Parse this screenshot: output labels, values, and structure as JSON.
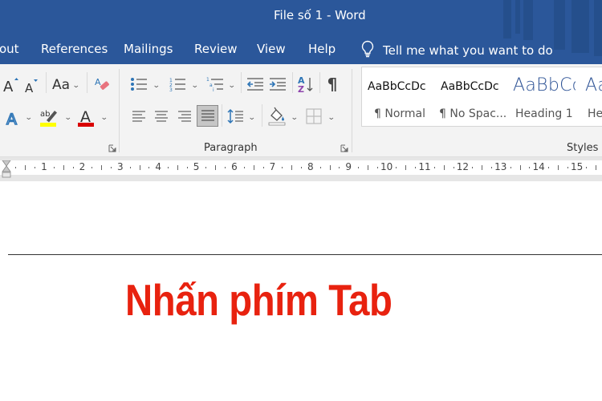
{
  "window": {
    "title": "File số 1  -  Word"
  },
  "tabs": [
    {
      "label": "out",
      "partial": true
    },
    {
      "label": "References"
    },
    {
      "label": "Mailings"
    },
    {
      "label": "Review"
    },
    {
      "label": "View"
    },
    {
      "label": "Help"
    }
  ],
  "tell_me": {
    "icon": "lightbulb-icon",
    "placeholder": "Tell me what you want to do"
  },
  "ribbon": {
    "font_group": {
      "buttons": [
        {
          "name": "grow-font",
          "icon": "grow-font-icon"
        },
        {
          "name": "shrink-font",
          "icon": "shrink-font-icon"
        },
        {
          "name": "change-case",
          "icon": "change-case-icon",
          "label": "Aa"
        },
        {
          "name": "clear-formatting",
          "icon": "eraser-icon"
        },
        {
          "name": "text-effects",
          "icon": "text-effects-icon"
        },
        {
          "name": "highlight-color",
          "icon": "highlighter-icon",
          "color": "#ffff00"
        },
        {
          "name": "font-color",
          "icon": "font-color-icon",
          "color": "#e00000"
        }
      ]
    },
    "paragraph_group": {
      "label": "Paragraph",
      "buttons": [
        {
          "name": "bullets",
          "icon": "bullets-icon"
        },
        {
          "name": "numbering",
          "icon": "numbering-icon"
        },
        {
          "name": "multilevel-list",
          "icon": "multilevel-list-icon"
        },
        {
          "name": "decrease-indent",
          "icon": "decrease-indent-icon"
        },
        {
          "name": "increase-indent",
          "icon": "increase-indent-icon"
        },
        {
          "name": "sort",
          "icon": "sort-az-icon"
        },
        {
          "name": "show-hide",
          "icon": "pilcrow-icon",
          "label": "¶"
        },
        {
          "name": "align-left",
          "icon": "align-left-icon"
        },
        {
          "name": "align-center",
          "icon": "align-center-icon"
        },
        {
          "name": "align-right",
          "icon": "align-right-icon"
        },
        {
          "name": "justify",
          "icon": "justify-icon",
          "active": true
        },
        {
          "name": "line-spacing",
          "icon": "line-spacing-icon"
        },
        {
          "name": "shading",
          "icon": "paint-bucket-icon"
        },
        {
          "name": "borders",
          "icon": "borders-icon"
        }
      ]
    },
    "styles_group": {
      "label": "Styles",
      "items": [
        {
          "sample": "AaBbCcDc",
          "name": "¶ Normal"
        },
        {
          "sample": "AaBbCcDc",
          "name": "¶ No Spac..."
        },
        {
          "sample": "AaBbCc",
          "name": "Heading 1"
        },
        {
          "sample": "Aa",
          "name": "He"
        }
      ]
    }
  },
  "ruler": {
    "numbers": [
      "1",
      "2",
      "3",
      "4",
      "5",
      "6",
      "7",
      "8",
      "9",
      "10",
      "11",
      "12",
      "13",
      "14",
      "15"
    ]
  },
  "document": {
    "text": "Nhấn phím Tab",
    "text_color": "#e8220f"
  },
  "colors": {
    "title_bar": "#2b579a",
    "ribbon_bg": "#f3f3f3",
    "accent_blue": "#2e75b6"
  }
}
